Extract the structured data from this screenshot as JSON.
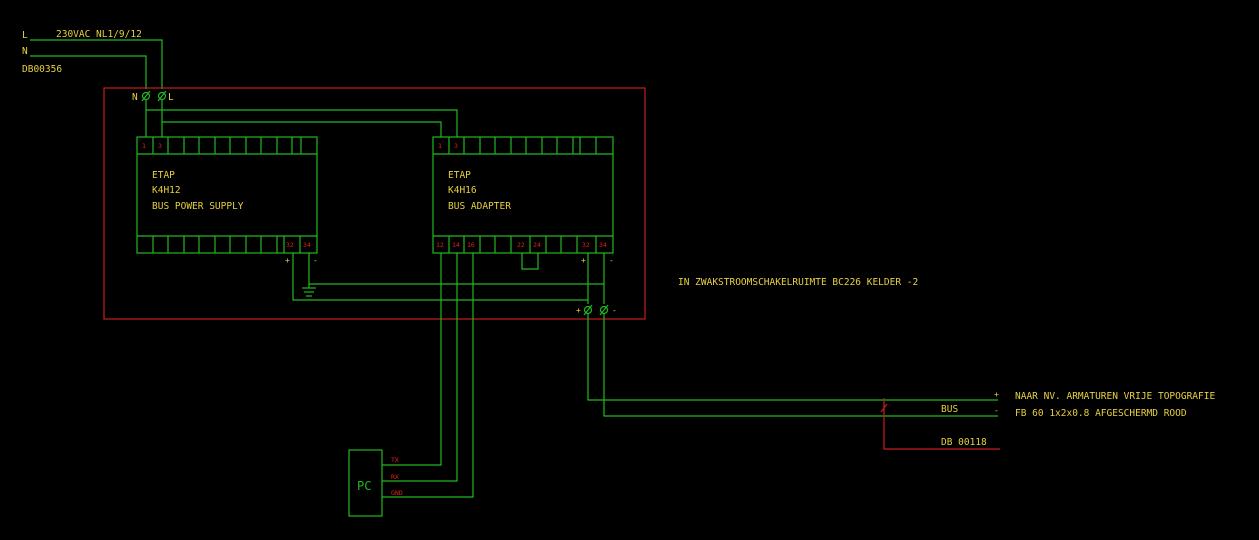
{
  "supply": {
    "line": "L",
    "neutral": "N",
    "voltage": "230VAC NL1/9/12",
    "db": "DB00356",
    "terminal_n": "N",
    "terminal_l": "L"
  },
  "psu": {
    "brand": "ETAP",
    "model": "K4H12",
    "name": "BUS POWER SUPPLY",
    "top_pins": [
      "1",
      "3"
    ],
    "bottom_pins": [
      "32",
      "34"
    ],
    "plus": "+",
    "minus": "-"
  },
  "adapter": {
    "brand": "ETAP",
    "model": "K4H16",
    "name": "BUS ADAPTER",
    "top_pins": [
      "1",
      "3"
    ],
    "bottom_pins": [
      "12",
      "14",
      "16",
      "22",
      "24",
      "32",
      "34"
    ],
    "plus": "+",
    "minus": "-"
  },
  "enclosure_note": "IN ZWAKSTROOMSCHAKELRUIMTE BC226 KELDER -2",
  "bus_terminal": {
    "plus": "+",
    "minus": "-"
  },
  "pc": {
    "label": "PC",
    "tx": "TX",
    "rx": "RX",
    "gnd": "GND"
  },
  "output": {
    "plus": "+",
    "minus": "-",
    "bus": "BUS",
    "line1": "NAAR NV. ARMATUREN VRIJE TOPOGRAFIE",
    "line2": "FB 60 1x2x0.8 AFGESCHERMD ROOD",
    "db": "DB 00118"
  },
  "colors": {
    "wire": "#22b822",
    "frame": "#c81e1e",
    "text": "#e6d040",
    "pin": "#e02020",
    "background": "#000000"
  }
}
